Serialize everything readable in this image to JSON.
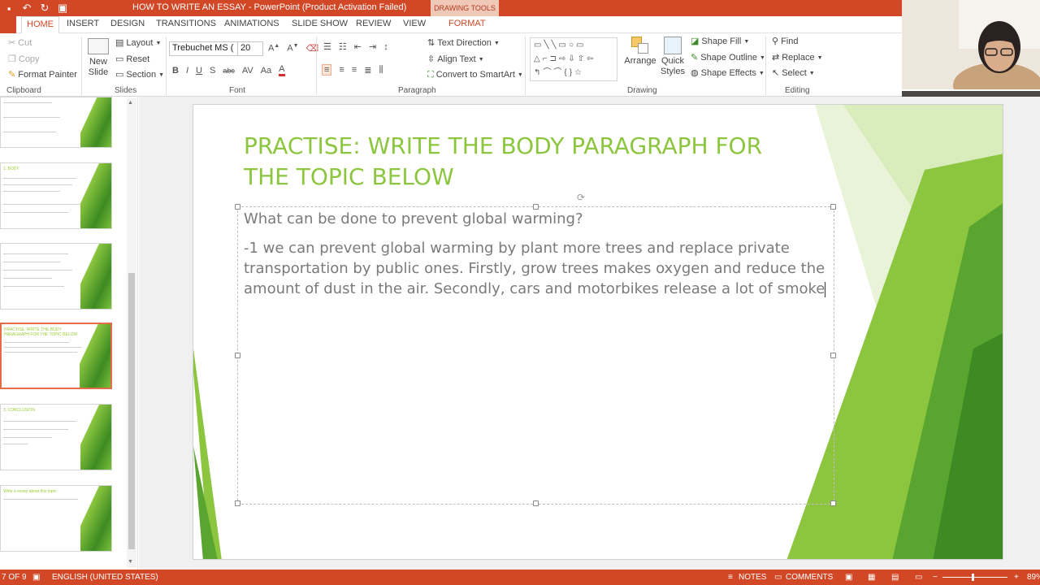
{
  "window": {
    "title": "HOW TO WRITE AN ESSAY - PowerPoint (Product Activation Failed)",
    "contextual_tab": "DRAWING TOOLS"
  },
  "tabs": [
    "HOME",
    "INSERT",
    "DESIGN",
    "TRANSITIONS",
    "ANIMATIONS",
    "SLIDE SHOW",
    "REVIEW",
    "VIEW",
    "FORMAT"
  ],
  "ribbon": {
    "clipboard": {
      "cut": "Cut",
      "copy": "Copy",
      "format_painter": "Format Painter",
      "label": "Clipboard"
    },
    "slides": {
      "new_slide": "New Slide",
      "layout": "Layout",
      "reset": "Reset",
      "section": "Section",
      "label": "Slides"
    },
    "font": {
      "family": "Trebuchet MS (",
      "size": "20",
      "label": "Font"
    },
    "paragraph": {
      "text_direction": "Text Direction",
      "align_text": "Align Text",
      "convert_smartart": "Convert to SmartArt",
      "label": "Paragraph"
    },
    "drawing": {
      "arrange": "Arrange",
      "quick_styles": "Quick Styles",
      "shape_fill": "Shape Fill",
      "shape_outline": "Shape Outline",
      "shape_effects": "Shape Effects",
      "label": "Drawing"
    },
    "editing": {
      "find": "Find",
      "replace": "Replace",
      "select": "Select",
      "label": "Editing"
    }
  },
  "slide": {
    "title": "PRACTISE: WRITE THE BODY PARAGRAPH FOR THE TOPIC BELOW",
    "question": "What can be done to prevent global warming?",
    "answer": "-1 we can prevent global warming by plant more trees and replace private transportation by public ones. Firstly, grow trees makes oxygen and reduce the amount of dust in the air. Secondly, cars and motorbikes release a lot of smoke"
  },
  "thumbnails": [
    {
      "title": ""
    },
    {
      "title": "2. BODY"
    },
    {
      "title": ""
    },
    {
      "title": "PRACTISE: WRITE THE BODY PARAGRAPH FOR THE TOPIC BELOW",
      "selected": true
    },
    {
      "title": "3. CONCLUSION"
    },
    {
      "title": "Write a essay about this topic"
    }
  ],
  "statusbar": {
    "slide_counter": "7 OF 9",
    "language": "ENGLISH (UNITED STATES)",
    "notes": "NOTES",
    "comments": "COMMENTS",
    "zoom": "89%"
  },
  "colors": {
    "accent": "#d24726",
    "slide_green": "#8cc63f",
    "dark_green": "#3d8b22"
  }
}
